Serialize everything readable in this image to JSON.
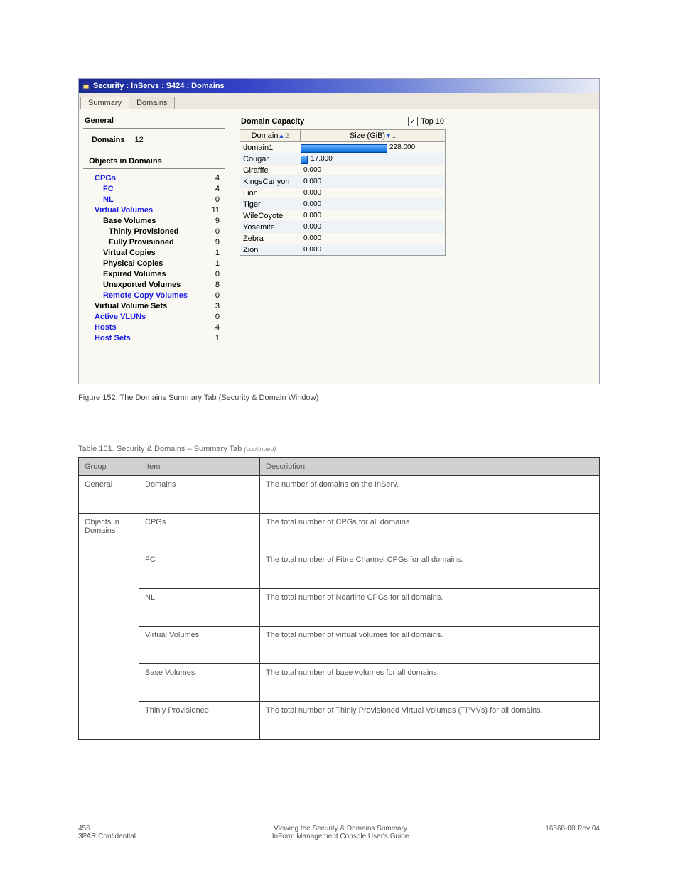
{
  "titlebar": "Security : InServs : S424 : Domains",
  "tabs": {
    "summary": "Summary",
    "domains": "Domains"
  },
  "general": {
    "heading": "General",
    "domains_label": "Domains",
    "domains_value": "12",
    "objects_heading": "Objects in Domains",
    "items": [
      {
        "label": "CPGs",
        "value": "4",
        "cls": "link ind1"
      },
      {
        "label": "FC",
        "value": "4",
        "cls": "link ind2"
      },
      {
        "label": "NL",
        "value": "0",
        "cls": "link ind2"
      },
      {
        "label": "Virtual Volumes",
        "value": "11",
        "cls": "link ind1"
      },
      {
        "label": "Base Volumes",
        "value": "9",
        "cls": "bold ind2"
      },
      {
        "label": "Thinly Provisioned",
        "value": "0",
        "cls": "bold ind3"
      },
      {
        "label": "Fully Provisioned",
        "value": "9",
        "cls": "bold ind3"
      },
      {
        "label": "Virtual Copies",
        "value": "1",
        "cls": "bold ind2"
      },
      {
        "label": "Physical Copies",
        "value": "1",
        "cls": "bold ind2"
      },
      {
        "label": "Expired Volumes",
        "value": "0",
        "cls": "bold ind2"
      },
      {
        "label": "Unexported Volumes",
        "value": "8",
        "cls": "bold ind2"
      },
      {
        "label": "Remote Copy Volumes",
        "value": "0",
        "cls": "link ind2"
      },
      {
        "label": "Virtual Volume Sets",
        "value": "3",
        "cls": "bold ind1"
      },
      {
        "label": "Active VLUNs",
        "value": "0",
        "cls": "link ind1"
      },
      {
        "label": "Hosts",
        "value": "4",
        "cls": "link ind1"
      },
      {
        "label": "Host Sets",
        "value": "1",
        "cls": "link ind1"
      }
    ]
  },
  "capacity": {
    "heading": "Domain Capacity",
    "top10_label": "Top 10",
    "top10_checked": true,
    "col_domain": "Domain",
    "col_size": "Size (GiB)",
    "sort_domain": "2",
    "sort_size": "1",
    "rows": [
      {
        "name": "domain1",
        "value": "228.000",
        "pct": 60
      },
      {
        "name": "Cougar",
        "value": "17.000",
        "pct": 5
      },
      {
        "name": "Girafffe",
        "value": "0.000",
        "pct": 0
      },
      {
        "name": "KingsCanyon",
        "value": "0.000",
        "pct": 0
      },
      {
        "name": "Lion",
        "value": "0.000",
        "pct": 0
      },
      {
        "name": "Tiger",
        "value": "0.000",
        "pct": 0
      },
      {
        "name": "WileCoyote",
        "value": "0.000",
        "pct": 0
      },
      {
        "name": "Yosemite",
        "value": "0.000",
        "pct": 0
      },
      {
        "name": "Zebra",
        "value": "0.000",
        "pct": 0
      },
      {
        "name": "Zion",
        "value": "0.000",
        "pct": 0
      }
    ]
  },
  "fig_caption": "Figure 152. The Domains Summary Tab (Security & Domain Window)",
  "doc_table_title": "Table 101. Security & Domains – Summary Tab",
  "doc_table_cont": "(continued)",
  "doc_table": {
    "head": [
      "Group",
      "Item",
      "Description"
    ],
    "rows": [
      {
        "c1": "General",
        "c2": "Domains",
        "c3": "The number of domains on the InServ.",
        "rs1": 1
      },
      {
        "c1": "Objects in Domains",
        "c2": "CPGs",
        "c3": "The total number of CPGs for all domains.",
        "rs1": 6
      },
      {
        "c1": "",
        "c2": "FC",
        "c3": "The total number of Fibre Channel CPGs for all domains."
      },
      {
        "c1": "",
        "c2": "NL",
        "c3": "The total number of Nearline CPGs for all domains."
      },
      {
        "c1": "",
        "c2": "Virtual Volumes",
        "c3": "The total number of virtual volumes for all domains."
      },
      {
        "c1": "",
        "c2": "Base Volumes",
        "c3": "The total number of base volumes for all domains."
      },
      {
        "c1": "",
        "c2": "Thinly Provisioned",
        "c3": "The total number of Thinly Provisioned Virtual Volumes (TPVVs) for all domains."
      }
    ]
  },
  "chart_data": {
    "type": "bar",
    "title": "Domain Capacity – Size (GiB)",
    "xlabel": "Size (GiB)",
    "ylabel": "Domain",
    "categories": [
      "domain1",
      "Cougar",
      "Girafffe",
      "KingsCanyon",
      "Lion",
      "Tiger",
      "WileCoyote",
      "Yosemite",
      "Zebra",
      "Zion"
    ],
    "values": [
      228.0,
      17.0,
      0.0,
      0.0,
      0.0,
      0.0,
      0.0,
      0.0,
      0.0,
      0.0
    ]
  },
  "footer": {
    "left_num": "456",
    "left_sub": "3PAR Confidential",
    "center_top": "Viewing the Security & Domains Summary",
    "center_sub": "InForm Management Console User's Guide",
    "right": "16566-00 Rev 04"
  }
}
